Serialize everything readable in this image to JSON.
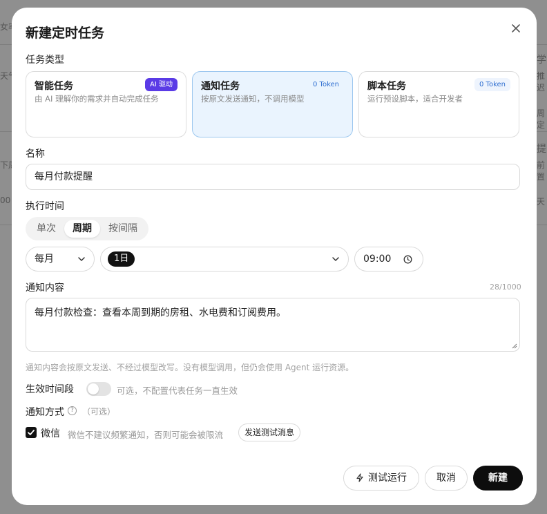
{
  "background": {
    "fragments": [
      "女率",
      "学",
      "天气",
      "推迟",
      "周定",
      "提",
      "下周",
      "前置",
      "00",
      "天"
    ]
  },
  "dialog": {
    "title": "新建定时任务",
    "close_icon": "close-icon",
    "task_type": {
      "label": "任务类型",
      "cards": [
        {
          "title": "智能任务",
          "desc": "由 AI 理解你的需求并自动完成任务",
          "badge": "AI 驱动",
          "selected": false
        },
        {
          "title": "通知任务",
          "desc": "按原文发送通知，不调用模型",
          "badge": "0 Token",
          "selected": true
        },
        {
          "title": "脚本任务",
          "desc": "运行预设脚本，适合开发者",
          "badge": "0 Token",
          "selected": false
        }
      ]
    },
    "name": {
      "label": "名称",
      "value": "每月付款提醒"
    },
    "schedule": {
      "label": "执行时间",
      "modes": [
        "单次",
        "周期",
        "按间隔"
      ],
      "active_mode": "周期",
      "frequency": "每月",
      "day_chip": "1日",
      "time": "09:00"
    },
    "content": {
      "label": "通知内容",
      "counter": "28/1000",
      "value": "每月付款检查：查看本周到期的房租、水电费和订阅费用。",
      "hint": "通知内容会按原文发送、不经过模型改写。没有模型调用，但仍会使用 Agent 运行资源。"
    },
    "effective_period": {
      "label": "生效时间段",
      "hint": "可选，不配置代表任务一直生效",
      "enabled": false
    },
    "notify": {
      "label": "通知方式",
      "optional": "（可选）",
      "wechat_label": "微信",
      "wechat_checked": true,
      "wechat_hint": "微信不建议频繁通知，否则可能会被限流",
      "test_message_button": "发送测试消息"
    },
    "footer": {
      "test_run": "测试运行",
      "cancel": "取消",
      "create": "新建"
    }
  },
  "colors": {
    "accent": "#5a3be6",
    "selected_bg": "#eaf4fe",
    "token_text": "#2f6fd1",
    "primary": "#0d0d0d"
  }
}
